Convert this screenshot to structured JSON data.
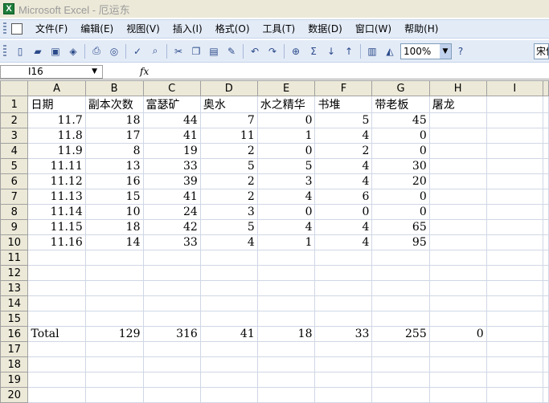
{
  "window": {
    "title": "Microsoft Excel - 厄运东",
    "app_icon": "X"
  },
  "menu": [
    "文件(F)",
    "编辑(E)",
    "视图(V)",
    "插入(I)",
    "格式(O)",
    "工具(T)",
    "数据(D)",
    "窗口(W)",
    "帮助(H)"
  ],
  "toolbar": {
    "zoom": "100%",
    "font": "宋体"
  },
  "formula_bar": {
    "name_box": "I16",
    "fx": "fx",
    "formula": ""
  },
  "columns": [
    "A",
    "B",
    "C",
    "D",
    "E",
    "F",
    "G",
    "H",
    "I"
  ],
  "rows": [
    [
      "日期",
      "副本次数",
      "富瑟矿",
      "奥水",
      "水之精华",
      "书堆",
      "带老板",
      "屠龙",
      ""
    ],
    [
      "11.7",
      "18",
      "44",
      "7",
      "0",
      "5",
      "45",
      "",
      ""
    ],
    [
      "11.8",
      "17",
      "41",
      "11",
      "1",
      "4",
      "0",
      "",
      ""
    ],
    [
      "11.9",
      "8",
      "19",
      "2",
      "0",
      "2",
      "0",
      "",
      ""
    ],
    [
      "11.11",
      "13",
      "33",
      "5",
      "5",
      "4",
      "30",
      "",
      ""
    ],
    [
      "11.12",
      "16",
      "39",
      "2",
      "3",
      "4",
      "20",
      "",
      ""
    ],
    [
      "11.13",
      "15",
      "41",
      "2",
      "4",
      "6",
      "0",
      "",
      ""
    ],
    [
      "11.14",
      "10",
      "24",
      "3",
      "0",
      "0",
      "0",
      "",
      ""
    ],
    [
      "11.15",
      "18",
      "42",
      "5",
      "4",
      "4",
      "65",
      "",
      ""
    ],
    [
      "11.16",
      "14",
      "33",
      "4",
      "1",
      "4",
      "95",
      "",
      ""
    ],
    [
      "",
      "",
      "",
      "",
      "",
      "",
      "",
      "",
      ""
    ],
    [
      "",
      "",
      "",
      "",
      "",
      "",
      "",
      "",
      ""
    ],
    [
      "",
      "",
      "",
      "",
      "",
      "",
      "",
      "",
      ""
    ],
    [
      "",
      "",
      "",
      "",
      "",
      "",
      "",
      "",
      ""
    ],
    [
      "",
      "",
      "",
      "",
      "",
      "",
      "",
      "",
      ""
    ],
    [
      "Total",
      "129",
      "316",
      "41",
      "18",
      "33",
      "255",
      "0",
      ""
    ],
    [
      "",
      "",
      "",
      "",
      "",
      "",
      "",
      "",
      ""
    ],
    [
      "",
      "",
      "",
      "",
      "",
      "",
      "",
      "",
      ""
    ],
    [
      "",
      "",
      "",
      "",
      "",
      "",
      "",
      "",
      ""
    ],
    [
      "",
      "",
      "",
      "",
      "",
      "",
      "",
      "",
      ""
    ]
  ],
  "row_numbers": [
    "1",
    "2",
    "3",
    "4",
    "5",
    "6",
    "7",
    "8",
    "9",
    "10",
    "11",
    "12",
    "13",
    "14",
    "15",
    "16",
    "17",
    "18",
    "19",
    "20"
  ]
}
